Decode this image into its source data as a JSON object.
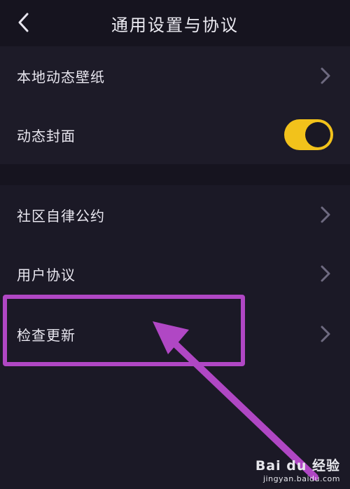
{
  "header": {
    "title": "通用设置与协议",
    "back_icon": "chevron-left-icon"
  },
  "settings_group_1": {
    "items": [
      {
        "label": "本地动态壁纸",
        "control": "chevron-right-icon"
      },
      {
        "label": "动态封面",
        "control": "toggle",
        "toggle_on": true
      }
    ]
  },
  "settings_group_2": {
    "items": [
      {
        "label": "社区自律公约",
        "control": "chevron-right-icon"
      },
      {
        "label": "用户协议",
        "control": "chevron-right-icon"
      },
      {
        "label": "检查更新",
        "control": "chevron-right-icon"
      }
    ]
  },
  "colors": {
    "background": "#16141f",
    "toggle_on": "#f2c21b",
    "annotation": "#b047c4",
    "chevron": "#6e6a80"
  },
  "watermark": {
    "logo": "Bai du 经验",
    "url": "jingyan.baidu.com"
  }
}
